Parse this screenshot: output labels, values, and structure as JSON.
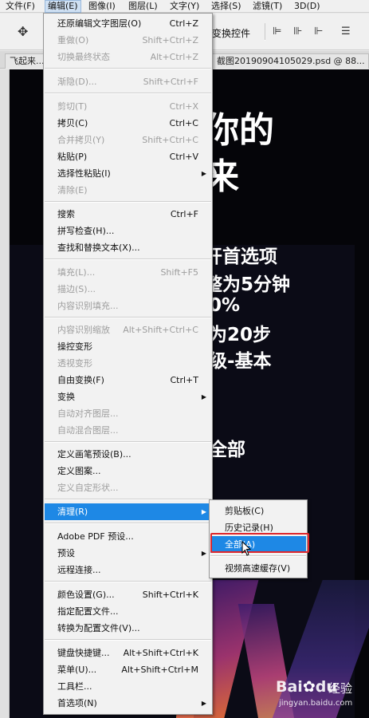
{
  "menubar": {
    "items": [
      {
        "label": "文件(F)"
      },
      {
        "label": "编辑(E)"
      },
      {
        "label": "图像(I)"
      },
      {
        "label": "图层(L)"
      },
      {
        "label": "文字(Y)"
      },
      {
        "label": "选择(S)"
      },
      {
        "label": "滤镜(T)"
      },
      {
        "label": "3D(D)"
      }
    ]
  },
  "options_bar": {
    "transform_controls_label": "变换控件",
    "tool_icon": "move-tool-icon"
  },
  "tabs": [
    {
      "label": "飞起来..."
    },
    {
      "label": "截图20190904105029.psd @ 88..."
    }
  ],
  "canvas": {
    "lines": [
      "你的",
      "来",
      "开首选项",
      "整为5分钟",
      "0%",
      "为20步",
      "级-基本",
      "全部"
    ]
  },
  "edit_menu": {
    "items": [
      {
        "label": "还原编辑文字图层(O)",
        "shortcut": "Ctrl+Z"
      },
      {
        "label": "重做(O)",
        "shortcut": "Shift+Ctrl+Z"
      },
      {
        "label": "切换最终状态",
        "shortcut": "Alt+Ctrl+Z"
      },
      {
        "label": "渐隐(D)...",
        "shortcut": "Shift+Ctrl+F"
      },
      {
        "label": "剪切(T)",
        "shortcut": "Ctrl+X"
      },
      {
        "label": "拷贝(C)",
        "shortcut": "Ctrl+C"
      },
      {
        "label": "合并拷贝(Y)",
        "shortcut": "Shift+Ctrl+C"
      },
      {
        "label": "粘贴(P)",
        "shortcut": "Ctrl+V"
      },
      {
        "label": "选择性粘贴(I)",
        "shortcut": ""
      },
      {
        "label": "清除(E)",
        "shortcut": ""
      },
      {
        "label": "搜索",
        "shortcut": "Ctrl+F"
      },
      {
        "label": "拼写检查(H)...",
        "shortcut": ""
      },
      {
        "label": "查找和替换文本(X)...",
        "shortcut": ""
      },
      {
        "label": "填充(L)...",
        "shortcut": "Shift+F5"
      },
      {
        "label": "描边(S)...",
        "shortcut": ""
      },
      {
        "label": "内容识别填充...",
        "shortcut": ""
      },
      {
        "label": "内容识别缩放",
        "shortcut": "Alt+Shift+Ctrl+C"
      },
      {
        "label": "操控变形",
        "shortcut": ""
      },
      {
        "label": "透视变形",
        "shortcut": ""
      },
      {
        "label": "自由变换(F)",
        "shortcut": "Ctrl+T"
      },
      {
        "label": "变换",
        "shortcut": ""
      },
      {
        "label": "自动对齐图层...",
        "shortcut": ""
      },
      {
        "label": "自动混合图层...",
        "shortcut": ""
      },
      {
        "label": "定义画笔预设(B)...",
        "shortcut": ""
      },
      {
        "label": "定义图案...",
        "shortcut": ""
      },
      {
        "label": "定义自定形状...",
        "shortcut": ""
      },
      {
        "label": "清理(R)",
        "shortcut": ""
      },
      {
        "label": "Adobe PDF 预设...",
        "shortcut": ""
      },
      {
        "label": "预设",
        "shortcut": ""
      },
      {
        "label": "远程连接...",
        "shortcut": ""
      },
      {
        "label": "颜色设置(G)...",
        "shortcut": "Shift+Ctrl+K"
      },
      {
        "label": "指定配置文件...",
        "shortcut": ""
      },
      {
        "label": "转换为配置文件(V)...",
        "shortcut": ""
      },
      {
        "label": "键盘快捷键...",
        "shortcut": "Alt+Shift+Ctrl+K"
      },
      {
        "label": "菜单(U)...",
        "shortcut": "Alt+Shift+Ctrl+M"
      },
      {
        "label": "工具栏...",
        "shortcut": ""
      },
      {
        "label": "首选项(N)",
        "shortcut": ""
      }
    ]
  },
  "purge_submenu": {
    "items": [
      {
        "label": "剪贴板(C)"
      },
      {
        "label": "历史记录(H)"
      },
      {
        "label": "全部(A)"
      },
      {
        "label": "视频高速缓存(V)"
      }
    ]
  },
  "watermark": {
    "logo_text_a": "Bai",
    "logo_text_b": "du",
    "logo_suffix": "经验",
    "url": "jingyan.baidu.com"
  },
  "colors": {
    "menu_highlight": "#1e88e5",
    "annotation_box": "#e0262b",
    "canvas_bg": "#050509"
  }
}
